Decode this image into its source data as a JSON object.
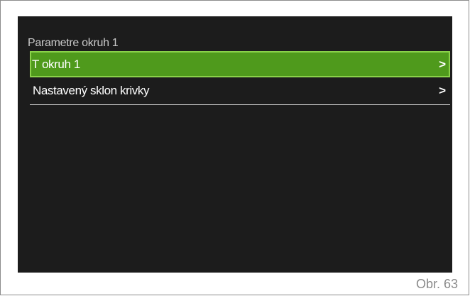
{
  "screen": {
    "title": "Parametre okruh 1",
    "menu": [
      {
        "label": "T okruh 1",
        "chevron": ">",
        "selected": true
      },
      {
        "label": "Nastavený sklon krivky",
        "chevron": ">",
        "selected": false
      }
    ]
  },
  "caption": "Obr. 63",
  "colors": {
    "screen_background": "#1c1c1c",
    "selected_background": "#4f9a1c",
    "selected_border": "#8ad24a",
    "text": "#ffffff",
    "title_text": "#c9c9c9"
  },
  "icons": {
    "chevron": "chevron-right-icon"
  }
}
